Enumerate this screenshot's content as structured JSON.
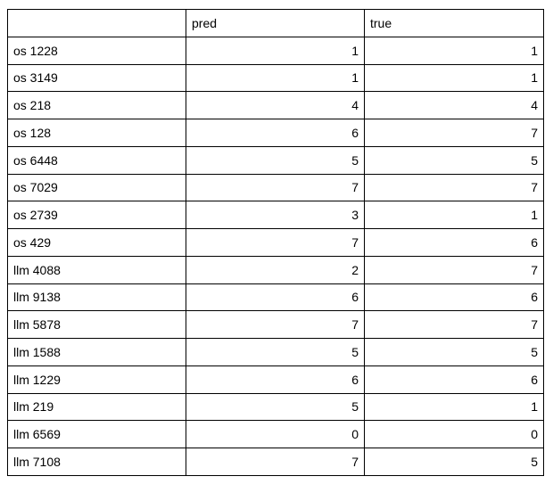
{
  "chart_data": {
    "type": "table",
    "columns": [
      "",
      "pred",
      "true"
    ],
    "rows": [
      {
        "label": "os 1228",
        "pred": 1,
        "true": 1
      },
      {
        "label": "os 3149",
        "pred": 1,
        "true": 1
      },
      {
        "label": "os 218",
        "pred": 4,
        "true": 4
      },
      {
        "label": "os 128",
        "pred": 6,
        "true": 7
      },
      {
        "label": "os 6448",
        "pred": 5,
        "true": 5
      },
      {
        "label": "os 7029",
        "pred": 7,
        "true": 7
      },
      {
        "label": "os 2739",
        "pred": 3,
        "true": 1
      },
      {
        "label": "os 429",
        "pred": 7,
        "true": 6
      },
      {
        "label": "llm 4088",
        "pred": 2,
        "true": 7
      },
      {
        "label": "llm 9138",
        "pred": 6,
        "true": 6
      },
      {
        "label": "llm 5878",
        "pred": 7,
        "true": 7
      },
      {
        "label": "llm 1588",
        "pred": 5,
        "true": 5
      },
      {
        "label": "llm 1229",
        "pred": 6,
        "true": 6
      },
      {
        "label": "llm 219",
        "pred": 5,
        "true": 1
      },
      {
        "label": "llm 6569",
        "pred": 0,
        "true": 0
      },
      {
        "label": "llm 7108",
        "pred": 7,
        "true": 5
      }
    ]
  }
}
